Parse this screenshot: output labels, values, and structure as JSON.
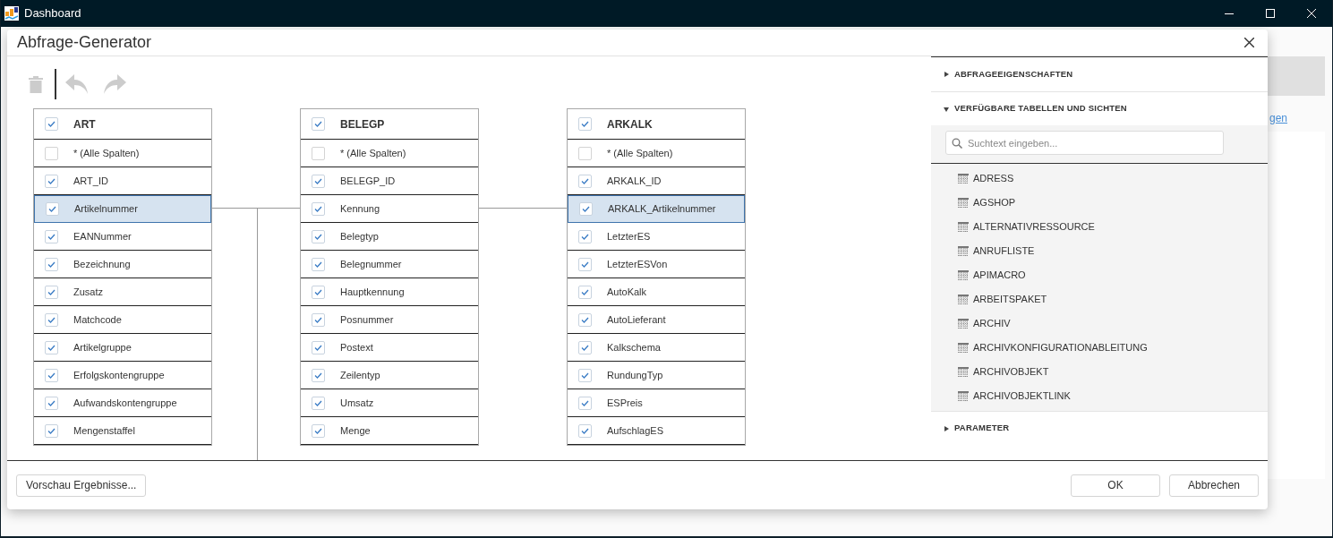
{
  "window": {
    "title": "Dashboard"
  },
  "background": {
    "link_fragment": "gen"
  },
  "dialog": {
    "title": "Abfrage-Generator",
    "toolbar": [
      {
        "kind": "delete",
        "disabled": true
      },
      {
        "kind": "undo",
        "disabled": true
      },
      {
        "kind": "redo",
        "disabled": true
      }
    ],
    "tables": [
      {
        "name": "ART",
        "checked": true,
        "columns": [
          {
            "name": "* (Alle Spalten)",
            "checked": false,
            "selected": false
          },
          {
            "name": "ART_ID",
            "checked": true,
            "selected": false
          },
          {
            "name": "Artikelnummer",
            "checked": true,
            "selected": true
          },
          {
            "name": "EANNummer",
            "checked": true,
            "selected": false
          },
          {
            "name": "Bezeichnung",
            "checked": true,
            "selected": false
          },
          {
            "name": "Zusatz",
            "checked": true,
            "selected": false
          },
          {
            "name": "Matchcode",
            "checked": true,
            "selected": false
          },
          {
            "name": "Artikelgruppe",
            "checked": true,
            "selected": false
          },
          {
            "name": "Erfolgskontengruppe",
            "checked": true,
            "selected": false
          },
          {
            "name": "Aufwandskontengruppe",
            "checked": true,
            "selected": false
          },
          {
            "name": "Mengenstaffel",
            "checked": true,
            "selected": false
          }
        ]
      },
      {
        "name": "BELEGP",
        "checked": true,
        "columns": [
          {
            "name": "* (Alle Spalten)",
            "checked": false,
            "selected": false
          },
          {
            "name": "BELEGP_ID",
            "checked": true,
            "selected": false
          },
          {
            "name": "Kennung",
            "checked": true,
            "selected": false
          },
          {
            "name": "Belegtyp",
            "checked": true,
            "selected": false
          },
          {
            "name": "Belegnummer",
            "checked": true,
            "selected": false
          },
          {
            "name": "Hauptkennung",
            "checked": true,
            "selected": false
          },
          {
            "name": "Posnummer",
            "checked": true,
            "selected": false
          },
          {
            "name": "Postext",
            "checked": true,
            "selected": false
          },
          {
            "name": "Zeilentyp",
            "checked": true,
            "selected": false
          },
          {
            "name": "Umsatz",
            "checked": true,
            "selected": false
          },
          {
            "name": "Menge",
            "checked": true,
            "selected": false
          }
        ]
      },
      {
        "name": "ARKALK",
        "checked": true,
        "columns": [
          {
            "name": "* (Alle Spalten)",
            "checked": false,
            "selected": false
          },
          {
            "name": "ARKALK_ID",
            "checked": true,
            "selected": false
          },
          {
            "name": "ARKALK_Artikelnummer",
            "checked": true,
            "selected": true
          },
          {
            "name": "LetzterES",
            "checked": true,
            "selected": false
          },
          {
            "name": "LetzterESVon",
            "checked": true,
            "selected": false
          },
          {
            "name": "AutoKalk",
            "checked": true,
            "selected": false
          },
          {
            "name": "AutoLieferant",
            "checked": true,
            "selected": false
          },
          {
            "name": "Kalkschema",
            "checked": true,
            "selected": false
          },
          {
            "name": "RundungTyp",
            "checked": true,
            "selected": false
          },
          {
            "name": "ESPreis",
            "checked": true,
            "selected": false
          },
          {
            "name": "AufschlagES",
            "checked": true,
            "selected": false
          }
        ]
      }
    ],
    "sections": [
      {
        "title": "ABFRAGEEIGENSCHAFTEN",
        "expanded": false
      },
      {
        "title": "VERFÜGBARE TABELLEN UND SICHTEN",
        "expanded": true,
        "search": {
          "placeholder": "Suchtext eingeben..."
        },
        "items": [
          "ADRESS",
          "AGSHOP",
          "ALTERNATIVRESSOURCE",
          "ANRUFLISTE",
          "APIMACRO",
          "ARBEITSPAKET",
          "ARCHIV",
          "ARCHIVKONFIGURATIONABLEITUNG",
          "ARCHIVOBJEKT",
          "ARCHIVOBJEKTLINK"
        ]
      },
      {
        "title": "PARAMETER",
        "expanded": false
      }
    ],
    "footer": {
      "preview_button": "Vorschau Ergebnisse...",
      "buttons": [
        "OK",
        "Abbrechen"
      ]
    }
  }
}
